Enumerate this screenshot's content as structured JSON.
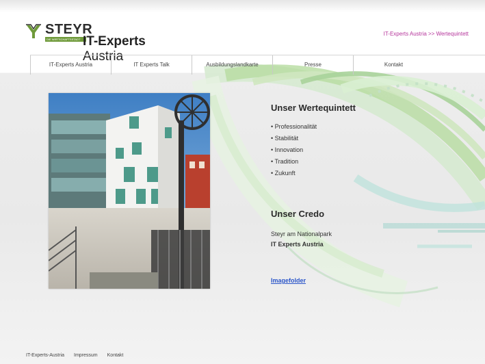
{
  "header": {
    "logo_name": "STEYR",
    "logo_tagline": "DIE WIRTSCHAFTSSTADT",
    "brand_bold": "IT-Experts",
    "brand_light": " Austria",
    "top_link": "IT-Experts Austria >> Wertequintett"
  },
  "nav": {
    "items": [
      {
        "label": "IT-Experts Austria"
      },
      {
        "label": "IT Experts Talk"
      },
      {
        "label": "Ausbildungslandkarte"
      },
      {
        "label": "Presse"
      },
      {
        "label": "Kontakt"
      }
    ]
  },
  "main": {
    "values_title": "Unser Wertequintett",
    "values": [
      "• Professionalität",
      "• Stabilität",
      "• Innovation",
      "• Tradition",
      "• Zukunft"
    ],
    "credo_title": "Unser Credo",
    "credo_line1": "Steyr am Nationalpark",
    "credo_line2": "IT Experts Austria",
    "imagefolder_link": "Imagefolder"
  },
  "footer": {
    "links": [
      {
        "label": "IT-Experts-Austria"
      },
      {
        "label": "Impressum"
      },
      {
        "label": "Kontakt"
      }
    ]
  },
  "colors": {
    "accent_green": "#7fb24a",
    "accent_teal": "#9fd0c7",
    "link_blue": "#2a55c9",
    "link_pink": "#b5359b"
  }
}
